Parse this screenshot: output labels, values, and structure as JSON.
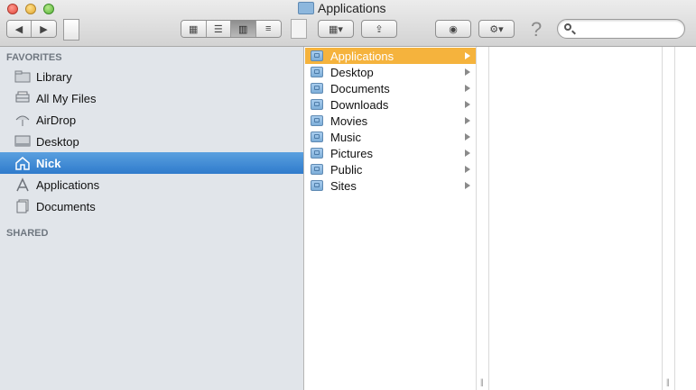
{
  "window": {
    "title": "Applications"
  },
  "toolbar": {
    "back_icon": "◀",
    "forward_icon": "▶",
    "view_icons": [
      "▦",
      "☰",
      "▥",
      "≡"
    ],
    "arrange_icon": "▦▾",
    "share_icon": "⇪",
    "quicklook_icon": "◉",
    "action_icon": "⚙▾",
    "help_icon": "?",
    "search_value": ""
  },
  "sidebar": {
    "favorites_label": "FAVORITES",
    "shared_label": "SHARED",
    "items": [
      {
        "label": "Library",
        "icon": "folder-icon"
      },
      {
        "label": "All My Files",
        "icon": "all-files-icon"
      },
      {
        "label": "AirDrop",
        "icon": "airdrop-icon"
      },
      {
        "label": "Desktop",
        "icon": "desktop-icon"
      },
      {
        "label": "Nick",
        "icon": "home-icon",
        "selected": true
      },
      {
        "label": "Applications",
        "icon": "applications-icon"
      },
      {
        "label": "Documents",
        "icon": "documents-icon"
      }
    ]
  },
  "columns": {
    "first": [
      {
        "label": "Applications",
        "selected": true
      },
      {
        "label": "Desktop"
      },
      {
        "label": "Documents"
      },
      {
        "label": "Downloads"
      },
      {
        "label": "Movies"
      },
      {
        "label": "Music"
      },
      {
        "label": "Pictures"
      },
      {
        "label": "Public"
      },
      {
        "label": "Sites"
      }
    ]
  },
  "colors": {
    "selection": "#f5b33d",
    "sidebar_selection": "#3f8ad6",
    "sidebar_bg": "#e1e5ea"
  }
}
